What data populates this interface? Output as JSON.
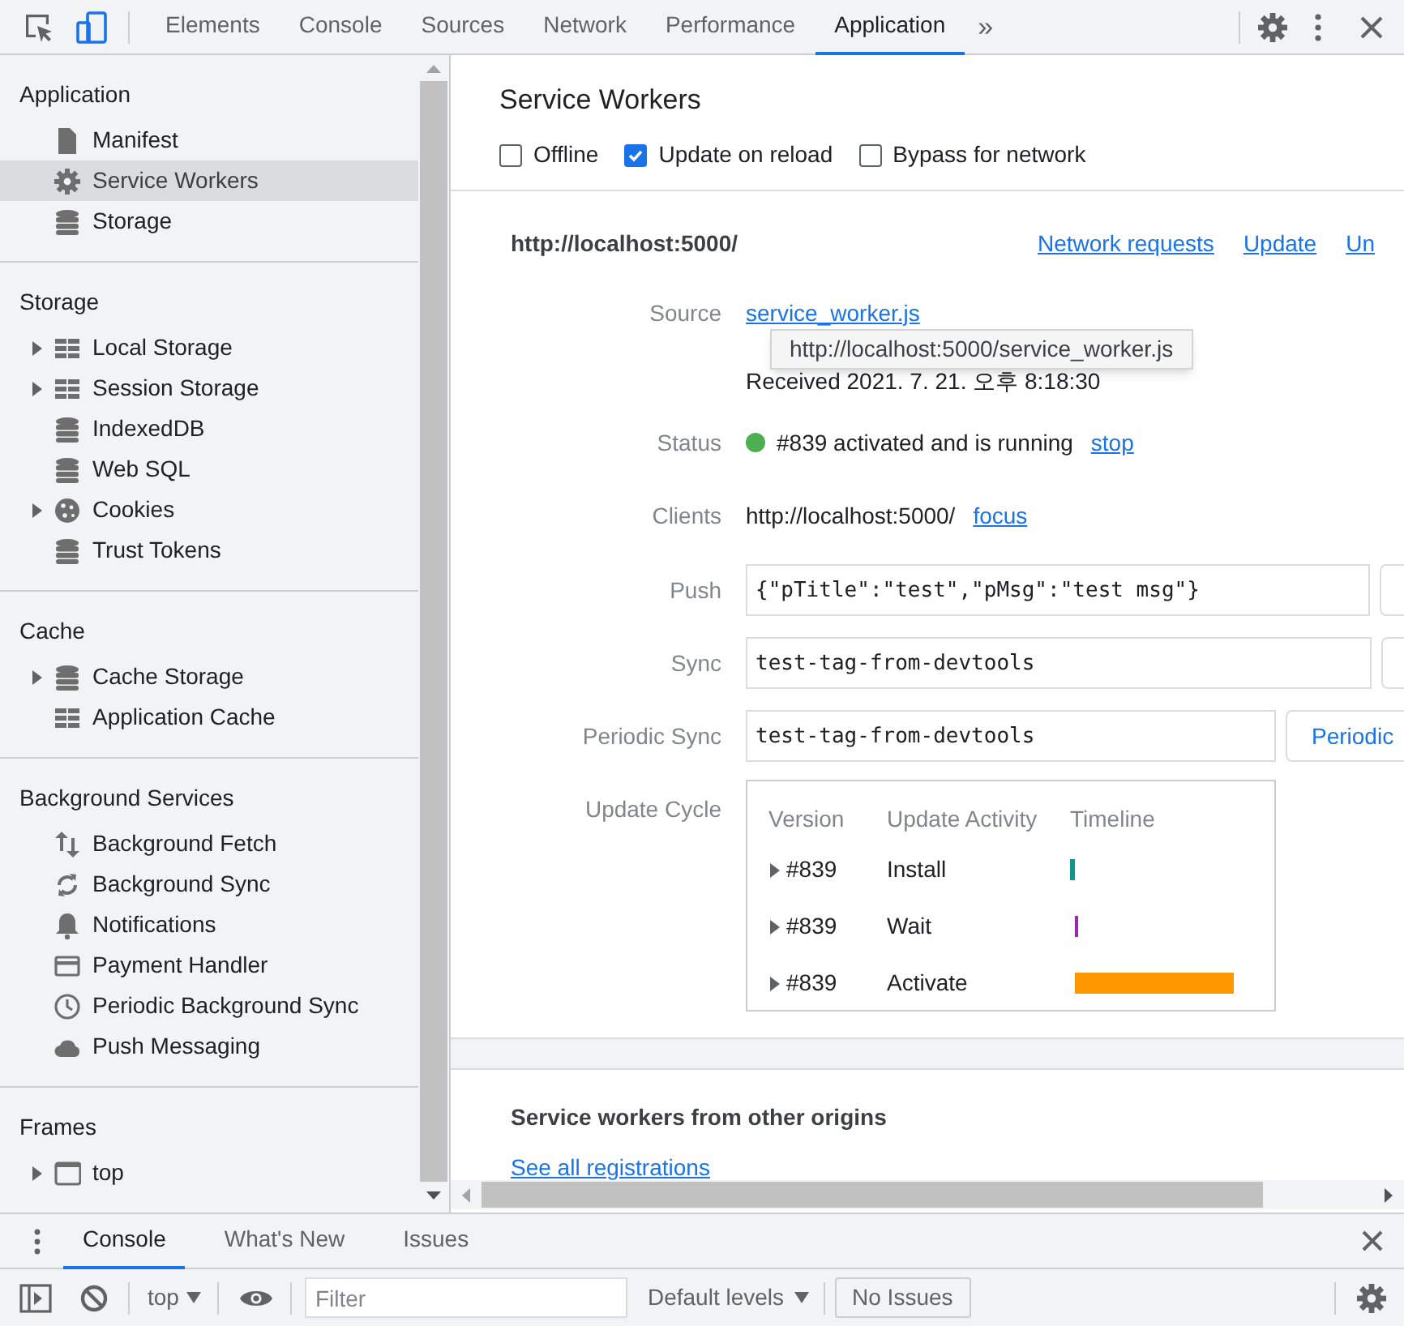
{
  "toolbar": {
    "tabs": [
      {
        "label": "Elements",
        "selected": false
      },
      {
        "label": "Console",
        "selected": false
      },
      {
        "label": "Sources",
        "selected": false
      },
      {
        "label": "Network",
        "selected": false
      },
      {
        "label": "Performance",
        "selected": false
      },
      {
        "label": "Application",
        "selected": true
      }
    ],
    "more_tabs": "»"
  },
  "sidebar": {
    "sections": [
      {
        "title": "Application",
        "items": [
          {
            "label": "Manifest",
            "kind": "file",
            "has_children": false,
            "selected": false
          },
          {
            "label": "Service Workers",
            "kind": "gear",
            "has_children": false,
            "selected": true
          },
          {
            "label": "Storage",
            "kind": "database",
            "has_children": false,
            "selected": false
          }
        ]
      },
      {
        "title": "Storage",
        "items": [
          {
            "label": "Local Storage",
            "kind": "table",
            "has_children": true,
            "selected": false
          },
          {
            "label": "Session Storage",
            "kind": "table",
            "has_children": true,
            "selected": false
          },
          {
            "label": "IndexedDB",
            "kind": "database",
            "has_children": false,
            "selected": false
          },
          {
            "label": "Web SQL",
            "kind": "database",
            "has_children": false,
            "selected": false
          },
          {
            "label": "Cookies",
            "kind": "cookie",
            "has_children": true,
            "selected": false
          },
          {
            "label": "Trust Tokens",
            "kind": "database",
            "has_children": false,
            "selected": false
          }
        ]
      },
      {
        "title": "Cache",
        "items": [
          {
            "label": "Cache Storage",
            "kind": "database",
            "has_children": true,
            "selected": false
          },
          {
            "label": "Application Cache",
            "kind": "table",
            "has_children": false,
            "selected": false
          }
        ]
      },
      {
        "title": "Background Services",
        "items": [
          {
            "label": "Background Fetch",
            "kind": "arrows",
            "has_children": false,
            "selected": false
          },
          {
            "label": "Background Sync",
            "kind": "sync",
            "has_children": false,
            "selected": false
          },
          {
            "label": "Notifications",
            "kind": "bell",
            "has_children": false,
            "selected": false
          },
          {
            "label": "Payment Handler",
            "kind": "card",
            "has_children": false,
            "selected": false
          },
          {
            "label": "Periodic Background Sync",
            "kind": "clock",
            "has_children": false,
            "selected": false
          },
          {
            "label": "Push Messaging",
            "kind": "cloud",
            "has_children": false,
            "selected": false
          }
        ]
      },
      {
        "title": "Frames",
        "items": [
          {
            "label": "top",
            "kind": "frame",
            "has_children": true,
            "selected": false
          }
        ]
      }
    ]
  },
  "main": {
    "title": "Service Workers",
    "options": [
      {
        "label": "Offline",
        "checked": false
      },
      {
        "label": "Update on reload",
        "checked": true
      },
      {
        "label": "Bypass for network",
        "checked": false
      }
    ],
    "origin": "http://localhost:5000/",
    "actions": [
      "Network requests",
      "Update",
      "Un"
    ],
    "source": {
      "label": "Source",
      "link": "service_worker.js",
      "received": "Received 2021. 7. 21. 오후 8:18:30",
      "tooltip": "http://localhost:5000/service_worker.js"
    },
    "status": {
      "label": "Status",
      "running": true,
      "text": "#839 activated and is running",
      "action": "stop"
    },
    "clients": {
      "label": "Clients",
      "url": "http://localhost:5000/",
      "action": "focus"
    },
    "push": {
      "label": "Push",
      "value": "{\"pTitle\":\"test\",\"pMsg\":\"test msg\"}"
    },
    "sync": {
      "label": "Sync",
      "value": "test-tag-from-devtools"
    },
    "periodic_sync": {
      "label": "Periodic Sync",
      "value": "test-tag-from-devtools",
      "button": "Periodic"
    },
    "update_cycle": {
      "label": "Update Cycle",
      "columns": [
        "Version",
        "Update Activity",
        "Timeline"
      ],
      "rows": [
        {
          "version": "#839",
          "activity": "Install",
          "expanded": false,
          "color": "#129688"
        },
        {
          "version": "#839",
          "activity": "Wait",
          "expanded": false,
          "color": "#9c27b0"
        },
        {
          "version": "#839",
          "activity": "Activate",
          "expanded": false,
          "color": "#ff9800"
        }
      ]
    },
    "other_origins": {
      "title": "Service workers from other origins",
      "link": "See all registrations"
    }
  },
  "drawer": {
    "tabs": [
      {
        "label": "Console",
        "selected": true
      },
      {
        "label": "What's New",
        "selected": false
      },
      {
        "label": "Issues",
        "selected": false
      }
    ],
    "context": "top",
    "filter_placeholder": "Filter",
    "levels": "Default levels",
    "issues": "No Issues"
  }
}
